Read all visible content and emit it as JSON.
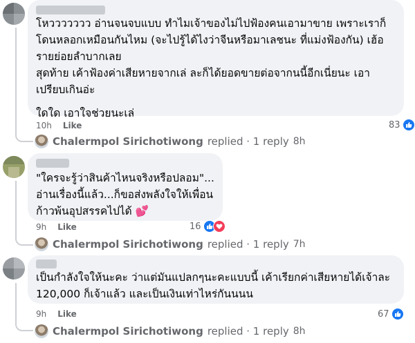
{
  "comments": [
    {
      "lines": [
        "โหววววววว อ่านจนจบแบบ ทำไมเจ้าของไม่ไปฟ้องคนเอามาขาย เพราะเราก็",
        "โดนหลอกเหมือนกันไหม (จะไปรู้ได้ไงว่าจีนหรือมาเลชนะ ที่แม่งฟ้องกัน) เฮ้อ",
        "รายย่อยลำบากเลย",
        "สุดท้าย เค้าฟ้องค่าเสียหายจากเล่ ละก็ได้ยอดขายต่อจากนนี้อีกเนี่ยนะ เอา",
        "เปรียบเกินอ่ะ",
        "",
        "ใดใด เอาใจช่วยนะเล่"
      ],
      "time": "10h",
      "like_label": "Like",
      "reaction_count": "83",
      "reply_author": "Chalermpol Sirichotiwong",
      "reply_text": "replied · 1 reply",
      "reply_time": "8h"
    },
    {
      "lines": [
        "\"ใครจะรู้ว่าสินค้าไหนจริงหรือปลอม\"...",
        "อ่านเรื่องนี้แล้ว...ก็ขอส่งพลังใจให้เพื่อน",
        "ก้าวพ้นอุปสรรคไปได้ 💕"
      ],
      "time": "9h",
      "like_label": "Like",
      "reaction_count": "16",
      "reply_author": "Chalermpol Sirichotiwong",
      "reply_text": "replied · 1 reply",
      "reply_time": "7h"
    },
    {
      "lines": [
        "เป็นกำลังใจให้นะคะ ว่าแต่มันแปลกๆนะคะแบบนี้ เค้าเรียกค่าเสียหายได้เจ้าละ",
        "120,000 ก็เจ้าแล้ว และเป็นเงินเท่าไหร่กันนนน"
      ],
      "time": "9h",
      "like_label": "Like",
      "reaction_count": "67",
      "reply_author": "Chalermpol Sirichotiwong",
      "reply_text": "replied · 1 reply",
      "reply_time": "8h"
    }
  ],
  "colors": {
    "bubble": "#f0f2f5",
    "meta": "#65676b",
    "like_blue": "#1877f2",
    "love_red": "#f33e58"
  }
}
